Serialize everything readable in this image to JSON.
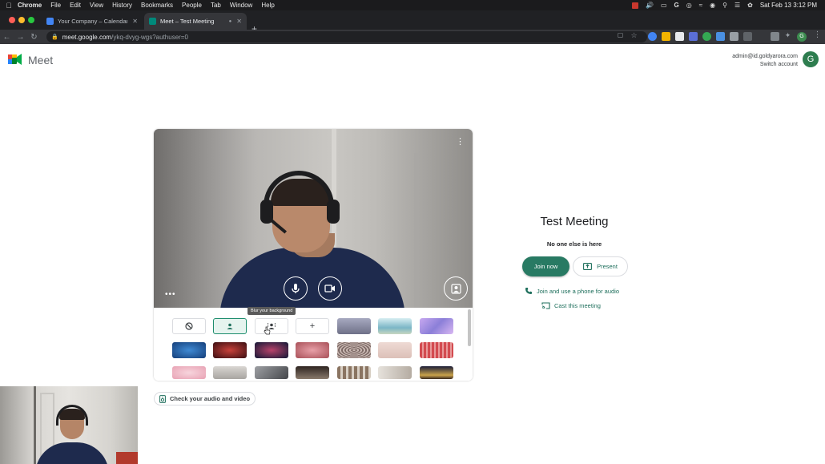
{
  "menubar": {
    "app": "Chrome",
    "items": [
      "File",
      "Edit",
      "View",
      "History",
      "Bookmarks",
      "People",
      "Tab",
      "Window",
      "Help"
    ],
    "clock": "Sat Feb 13  3:12 PM"
  },
  "browser": {
    "tabs": [
      {
        "title": "Your Company – Calendar - W",
        "active": false
      },
      {
        "title": "Meet – Test Meeting",
        "active": true
      }
    ],
    "url_host": "meet.google.com",
    "url_path": "/ykq-dvyg-wgs?authuser=0",
    "profile_initial": "G"
  },
  "header": {
    "logo_text": "Meet",
    "account_email": "admin@id.goldyarora.com",
    "switch_account": "Switch account",
    "avatar_initial": "G"
  },
  "preview": {
    "tooltip": "Blur your background",
    "effects_rows": [
      [
        "none",
        "slight-blur",
        "blur",
        "add",
        "#8d8fa3",
        "#9ec6d1",
        "#b39be0"
      ],
      [
        "#1f5ea8",
        "#7a1f22",
        "#1c2450",
        "#c86a72",
        "#9a8a86",
        "#e6cfc9",
        "#d35a5f"
      ],
      [
        "#f2c4cf",
        "#bfbcb8",
        "#6d6f73",
        "#4a3b33",
        "#6e5b4b",
        "#c9c3bc",
        "#2d2f4a"
      ]
    ],
    "selected_effect": "slight-blur"
  },
  "join": {
    "title": "Test Meeting",
    "status": "No one else is here",
    "join_now": "Join now",
    "present": "Present",
    "phone_audio": "Join and use a phone for audio",
    "cast": "Cast this meeting"
  },
  "check_audio": "Check your audio and video",
  "colors": {
    "accent": "#287a63",
    "link": "#1e6f5c",
    "chrome_dark": "#202124"
  }
}
